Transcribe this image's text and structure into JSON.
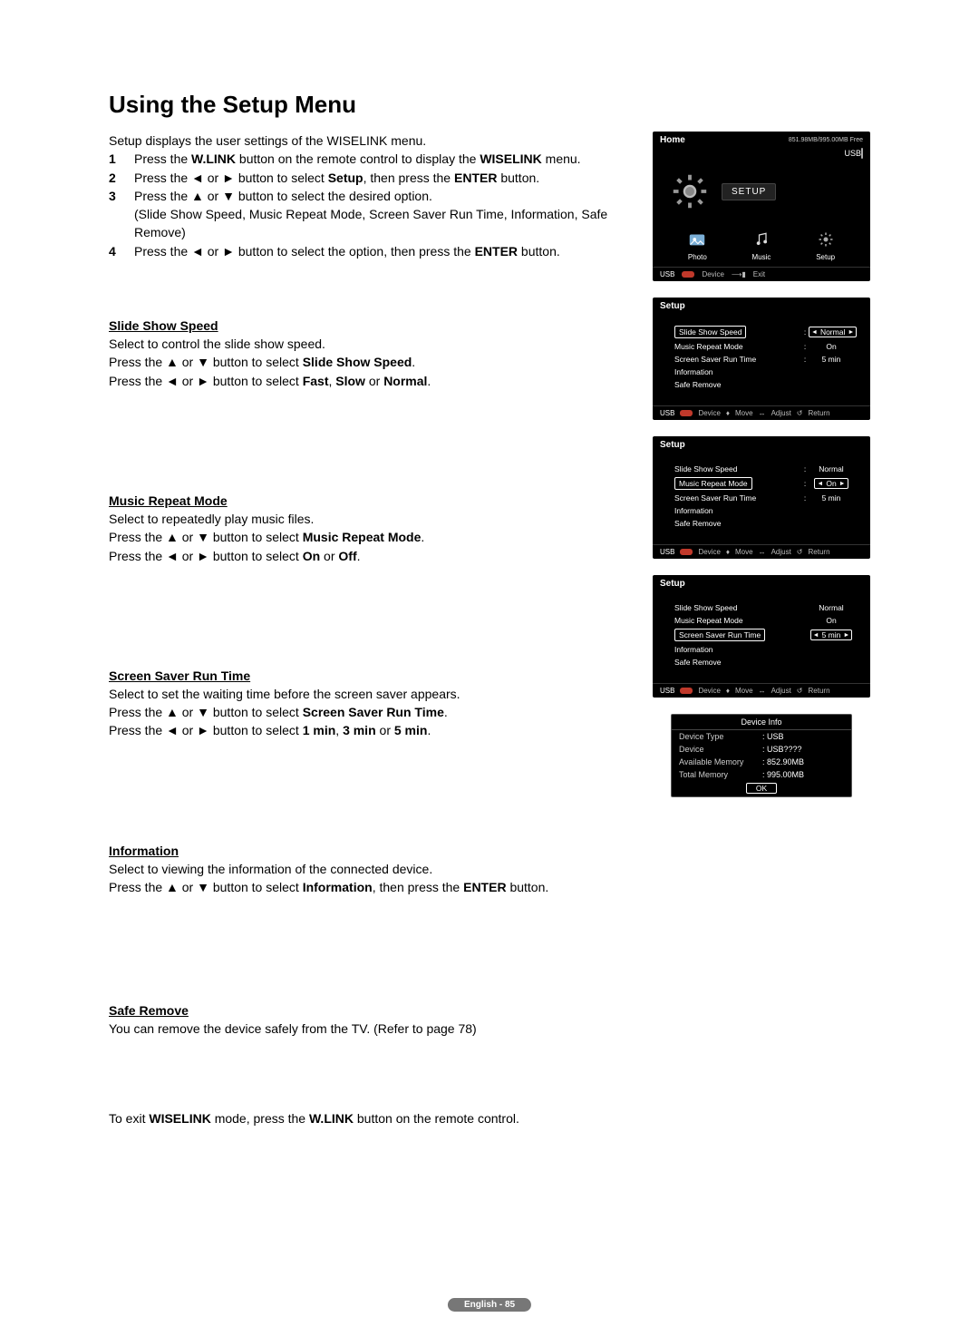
{
  "title": "Using the Setup Menu",
  "intro": "Setup displays the user settings of the WISELINK menu.",
  "steps": [
    {
      "n": "1",
      "text": "Press the W.LINK button on the remote control to display the WISELINK menu."
    },
    {
      "n": "2",
      "text": "Press the ◄ or ► button to select Setup, then press the ENTER button."
    },
    {
      "n": "3",
      "text": "Press the ▲ or ▼ button to select the desired option. (Slide Show Speed, Music Repeat Mode, Screen Saver Run Time, Information, Safe Remove)"
    },
    {
      "n": "4",
      "text": "Press the ◄ or ► button to select the option, then press the ENTER button."
    }
  ],
  "sections": {
    "slide": {
      "heading": "Slide Show Speed",
      "p1": "Select to control the slide show speed.",
      "p2": "Press the ▲ or ▼ button to select Slide Show Speed.",
      "p3": "Press the ◄ or ► button to select Fast, Slow or Normal."
    },
    "music": {
      "heading": "Music Repeat Mode",
      "p1": "Select to repeatedly play music files.",
      "p2": "Press the ▲ or ▼ button to select Music Repeat Mode.",
      "p3": "Press the ◄ or ► button to select On or Off."
    },
    "screen": {
      "heading": "Screen Saver Run Time",
      "p1": "Select to set the waiting time before the screen saver appears.",
      "p2": "Press the ▲ or ▼ button to select Screen Saver Run Time.",
      "p3": "Press the ◄ or ► button to select 1 min, 3 min or 5 min."
    },
    "info": {
      "heading": "Information",
      "p1": "Select to viewing the information of the connected device.",
      "p2": "Press the ▲ or ▼ button to select Information, then press the ENTER button."
    },
    "safe": {
      "heading": "Safe Remove",
      "p1": "You can remove the device safely from the TV. (Refer to page 78)"
    },
    "exit": "To exit WISELINK mode, press the W.LINK button on the remote control."
  },
  "shots": {
    "home": {
      "title": "Home",
      "usb_free": "851.98MB/995.00MB Free",
      "usb_label": "USB",
      "setup_label": "SETUP",
      "thumbs": {
        "photo": "Photo",
        "music": "Music",
        "setup": "Setup"
      },
      "footer": {
        "usb": "USB",
        "device": "Device",
        "exit": "Exit"
      }
    },
    "setup_common": {
      "title": "Setup",
      "rows": {
        "slide": "Slide Show Speed",
        "music": "Music Repeat Mode",
        "screen": "Screen Saver Run Time",
        "info": "Information",
        "safe": "Safe Remove"
      },
      "vals": {
        "normal": "Normal",
        "on": "On",
        "fivemin": "5 min"
      },
      "footer": {
        "usb": "USB",
        "device": "Device",
        "move": "Move",
        "adjust": "Adjust",
        "ret": "Return"
      }
    },
    "devinfo": {
      "title": "Device Info",
      "rows": [
        {
          "k": "Device Type",
          "v": ": USB"
        },
        {
          "k": "Device",
          "v": ": USB????"
        },
        {
          "k": "Available Memory",
          "v": ": 852.90MB"
        },
        {
          "k": "Total Memory",
          "v": ": 995.00MB"
        }
      ],
      "ok": "OK"
    }
  },
  "footer_label": "English - 85"
}
